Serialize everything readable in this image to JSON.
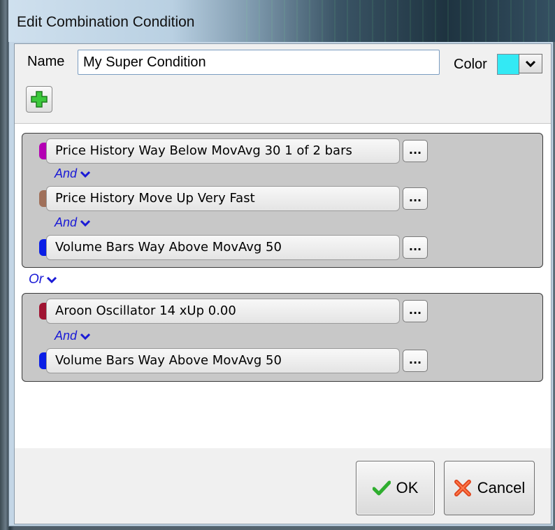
{
  "window": {
    "title": "Edit Combination Condition"
  },
  "form": {
    "name_label": "Name",
    "name_value": "My Super Condition",
    "color_label": "Color",
    "color_value": "#33e9f4"
  },
  "groups": [
    {
      "conditions": [
        {
          "label": "Price History Way Below MovAvg 30 1 of 2 bars",
          "color": "#b400b4",
          "edit_label": "..."
        },
        {
          "label": "Price History Move Up Very Fast",
          "color": "#a0705a",
          "edit_label": "..."
        },
        {
          "label": "Volume Bars Way Above  MovAvg 50",
          "color": "#0a1ee6",
          "edit_label": "..."
        }
      ],
      "operators": [
        "And",
        "And"
      ]
    },
    {
      "conditions": [
        {
          "label": "Aroon Oscillator 14 xUp 0.00",
          "color": "#a01432",
          "edit_label": "..."
        },
        {
          "label": "Volume Bars Way Above  MovAvg 50",
          "color": "#0a1ee6",
          "edit_label": "..."
        }
      ],
      "operators": [
        "And"
      ]
    }
  ],
  "group_operator": "Or",
  "buttons": {
    "ok_label": "OK",
    "cancel_label": "Cancel"
  },
  "icons": {
    "add": "plus-icon",
    "ok": "checkmark-icon",
    "cancel": "x-icon",
    "dropdown": "chevron-down-icon"
  }
}
